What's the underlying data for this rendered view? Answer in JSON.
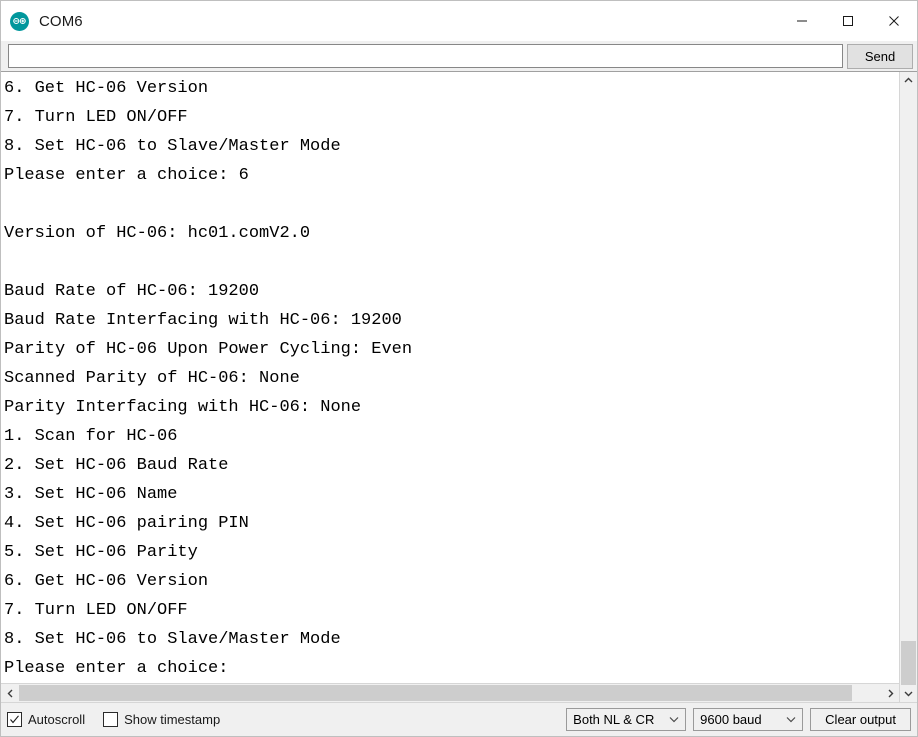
{
  "window": {
    "title": "COM6",
    "logo_icon": "arduino-infinity-icon",
    "controls": {
      "minimize": "minimize-icon",
      "maximize": "maximize-icon",
      "close": "close-icon"
    }
  },
  "send_row": {
    "input_value": "",
    "input_placeholder": "",
    "send_label": "Send"
  },
  "console": {
    "lines": [
      "6. Get HC-06 Version",
      "7. Turn LED ON/OFF",
      "8. Set HC-06 to Slave/Master Mode",
      "Please enter a choice: 6",
      "",
      "Version of HC-06: hc01.comV2.0",
      "",
      "Baud Rate of HC-06: 19200",
      "Baud Rate Interfacing with HC-06: 19200",
      "Parity of HC-06 Upon Power Cycling: Even",
      "Scanned Parity of HC-06: None",
      "Parity Interfacing with HC-06: None",
      "1. Scan for HC-06",
      "2. Set HC-06 Baud Rate",
      "3. Set HC-06 Name",
      "4. Set HC-06 pairing PIN",
      "5. Set HC-06 Parity",
      "6. Get HC-06 Version",
      "7. Turn LED ON/OFF",
      "8. Set HC-06 to Slave/Master Mode",
      "Please enter a choice:"
    ]
  },
  "scrollbars": {
    "up_icon": "chevron-up-icon",
    "down_icon": "chevron-down-icon",
    "left_icon": "chevron-left-icon",
    "right_icon": "chevron-right-icon"
  },
  "statusbar": {
    "autoscroll_label": "Autoscroll",
    "autoscroll_checked": true,
    "timestamp_label": "Show timestamp",
    "timestamp_checked": false,
    "line_ending": "Both NL & CR",
    "baud_rate": "9600 baud",
    "clear_label": "Clear output"
  },
  "colors": {
    "accent": "#00979c",
    "console_bg": "#ffffff",
    "console_text": "#000000",
    "chrome": "#f0f0f0"
  }
}
